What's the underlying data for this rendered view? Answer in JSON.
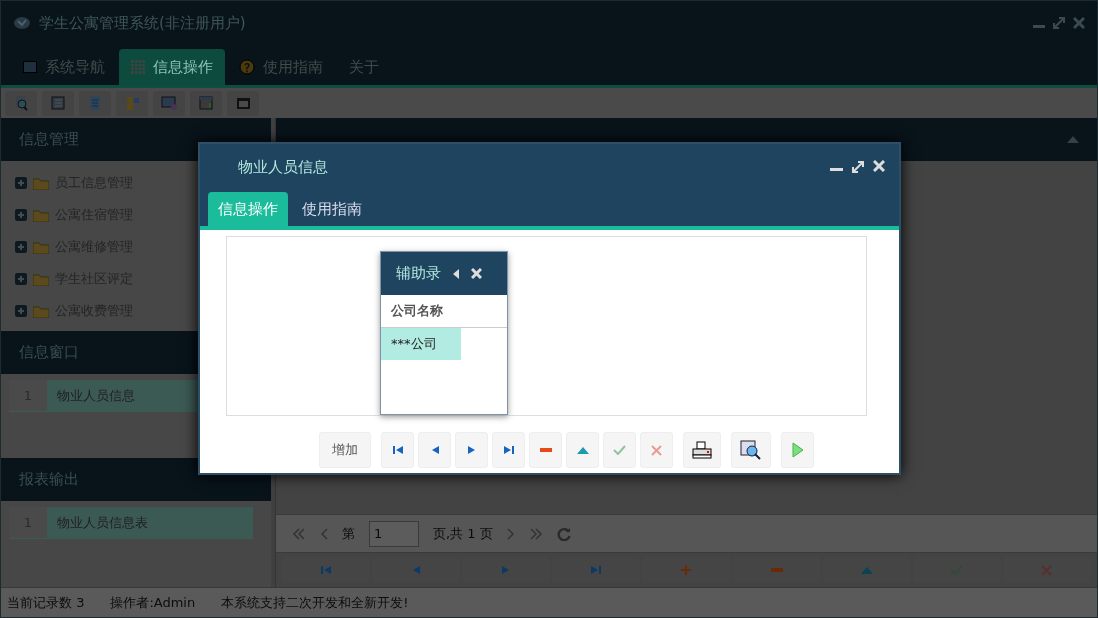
{
  "window": {
    "title": "学生公寓管理系统(非注册用户)"
  },
  "main_tabs": [
    {
      "label": "系统导航",
      "kind": "monitor",
      "selected": false
    },
    {
      "label": "信息操作",
      "kind": "grid",
      "selected": true
    },
    {
      "label": "使用指南",
      "kind": "help",
      "selected": false
    },
    {
      "label": "关于",
      "kind": "none",
      "selected": false
    }
  ],
  "sidebar": {
    "sections": [
      {
        "title": "信息管理",
        "kind": "tree",
        "items": [
          {
            "label": "员工信息管理",
            "expanded": false
          },
          {
            "label": "公寓住宿管理",
            "expanded": false
          },
          {
            "label": "公寓维修管理",
            "expanded": false
          },
          {
            "label": "学生社区评定",
            "expanded": false
          },
          {
            "label": "公寓收费管理",
            "expanded": false
          }
        ]
      },
      {
        "title": "信息窗口",
        "kind": "list",
        "items": [
          {
            "index": "1",
            "label": "物业人员信息",
            "selected": true
          }
        ]
      },
      {
        "title": "报表输出",
        "kind": "list",
        "items": [
          {
            "index": "1",
            "label": "物业人员信息表",
            "selected": true
          }
        ]
      }
    ]
  },
  "pager": {
    "page_label": "第",
    "page": "1",
    "total": "页,共 1 页"
  },
  "record_buttons": [
    {
      "kind": "first"
    },
    {
      "kind": "prev"
    },
    {
      "kind": "next"
    },
    {
      "kind": "last"
    },
    {
      "kind": "add"
    },
    {
      "kind": "remove"
    },
    {
      "kind": "up"
    },
    {
      "kind": "confirm"
    },
    {
      "kind": "cancel"
    }
  ],
  "dialog": {
    "title": "物业人员信息",
    "tabs": [
      {
        "label": "信息操作",
        "selected": true
      },
      {
        "label": "使用指南",
        "selected": false
      }
    ],
    "popup": {
      "title": "辅助录",
      "columns": [
        "公司名称"
      ],
      "rows": [
        {
          "cells": [
            "***公司"
          ],
          "selected": true
        }
      ]
    },
    "buttons": [
      {
        "kind": "text",
        "label": "增加"
      },
      {
        "kind": "first"
      },
      {
        "kind": "prev"
      },
      {
        "kind": "next"
      },
      {
        "kind": "last"
      },
      {
        "kind": "remove"
      },
      {
        "kind": "up"
      },
      {
        "kind": "confirm"
      },
      {
        "kind": "cancel"
      },
      {
        "kind": "print"
      },
      {
        "kind": "preview"
      },
      {
        "kind": "run"
      }
    ]
  },
  "status_bar": [
    "当前记录数 3",
    "操作者:Admin",
    "本系统支持二次开发和全新开发!"
  ]
}
